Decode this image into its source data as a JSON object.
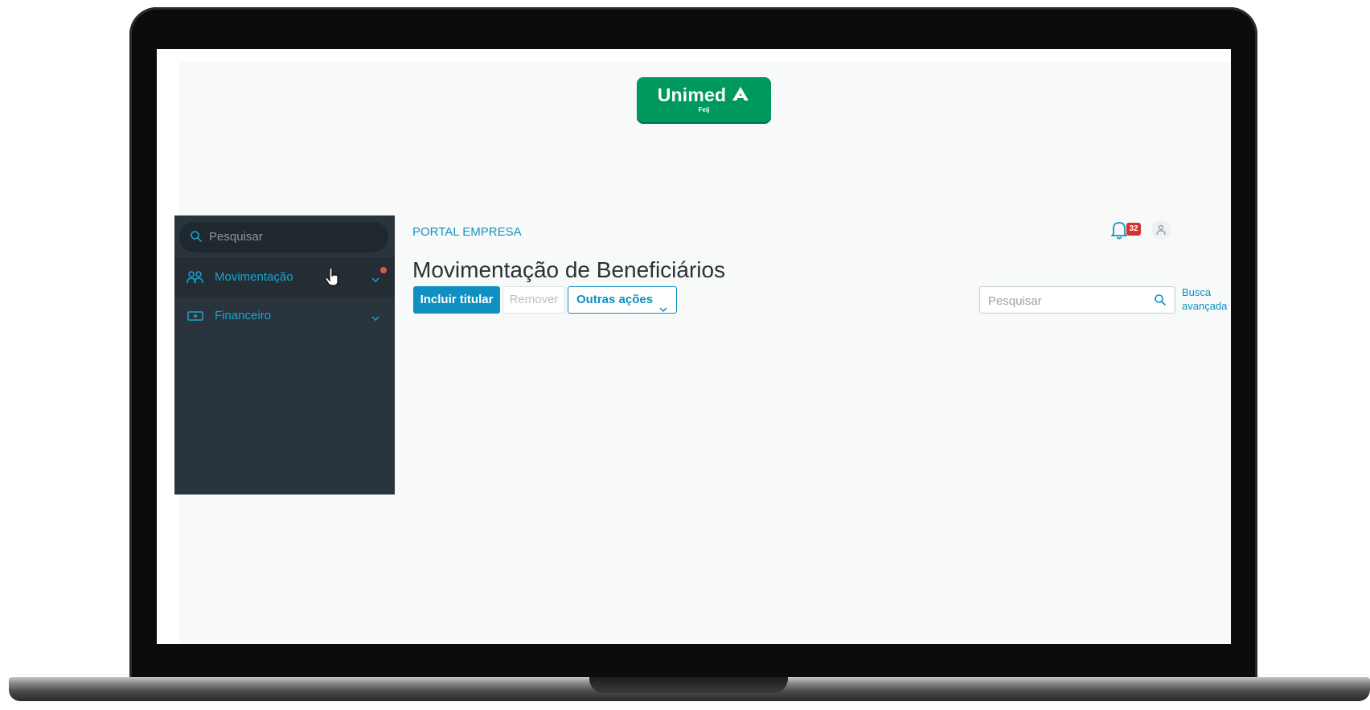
{
  "brand": {
    "logo_name": "Unimed",
    "logo_sub": "Feij",
    "color": "#00995d"
  },
  "sidebar": {
    "search_placeholder": "Pesquisar",
    "items": [
      {
        "label": "Movimentação",
        "icon": "users-icon",
        "active": true,
        "has_notification": true
      },
      {
        "label": "Financeiro",
        "icon": "money-icon",
        "active": false,
        "has_notification": false
      }
    ],
    "bg_color": "#29343c",
    "accent_color": "#1aa4cf"
  },
  "header": {
    "breadcrumb": "PORTAL EMPRESA",
    "notification_count": "32"
  },
  "main": {
    "title": "Movimentação de Beneficiários",
    "actions": {
      "primary_label": "Incluir titular",
      "remove_label": "Remover",
      "more_label": "Outras ações"
    },
    "search_placeholder": "Pesquisar",
    "advanced_search_line1": "Busca",
    "advanced_search_line2": "avançada"
  },
  "colors": {
    "primary": "#0f8fc2",
    "badge": "#d62f2f",
    "notification_dot": "#e0544b"
  }
}
